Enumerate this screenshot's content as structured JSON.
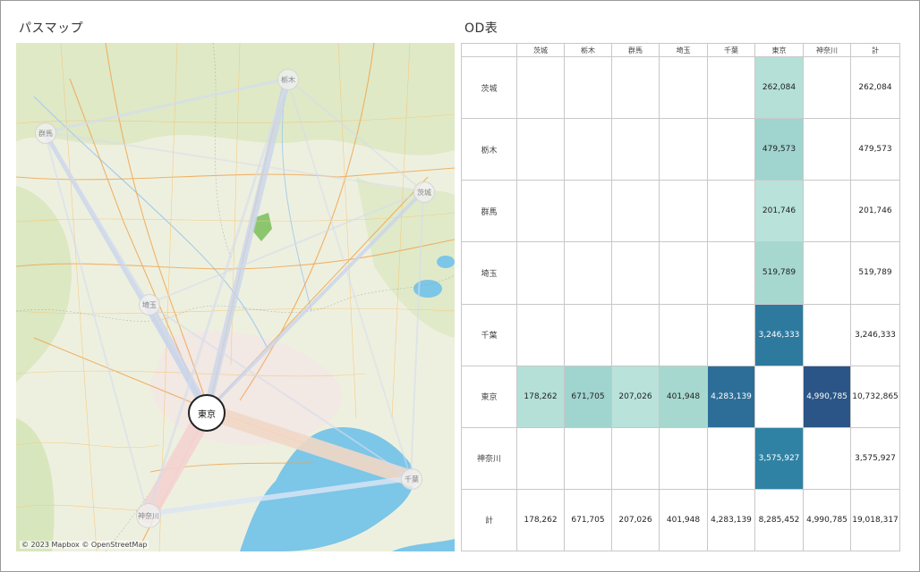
{
  "map": {
    "title": "パスマップ",
    "attribution": "© 2023 Mapbox © OpenStreetMap",
    "nodes": {
      "tochigi": "栃木",
      "gunma": "群馬",
      "ibaraki": "茨城",
      "saitama": "埼玉",
      "tokyo": "東京",
      "chiba": "千葉",
      "kanagawa": "神奈川"
    }
  },
  "od": {
    "title": "OD表",
    "columns": [
      "",
      "茨城",
      "栃木",
      "群馬",
      "埼玉",
      "千葉",
      "東京",
      "神奈川",
      "計"
    ],
    "rows": [
      {
        "label": "茨城",
        "cells": [
          "",
          "",
          "",
          "",
          "",
          "262,084",
          "",
          "262,084"
        ]
      },
      {
        "label": "栃木",
        "cells": [
          "",
          "",
          "",
          "",
          "",
          "479,573",
          "",
          "479,573"
        ]
      },
      {
        "label": "群馬",
        "cells": [
          "",
          "",
          "",
          "",
          "",
          "201,746",
          "",
          "201,746"
        ]
      },
      {
        "label": "埼玉",
        "cells": [
          "",
          "",
          "",
          "",
          "",
          "519,789",
          "",
          "519,789"
        ]
      },
      {
        "label": "千葉",
        "cells": [
          "",
          "",
          "",
          "",
          "",
          "3,246,333",
          "",
          "3,246,333"
        ]
      },
      {
        "label": "東京",
        "cells": [
          "178,262",
          "671,705",
          "207,026",
          "401,948",
          "4,283,139",
          "",
          "4,990,785",
          "10,732,865"
        ]
      },
      {
        "label": "神奈川",
        "cells": [
          "",
          "",
          "",
          "",
          "",
          "3,575,927",
          "",
          "3,575,927"
        ]
      },
      {
        "label": "計",
        "cells": [
          "178,262",
          "671,705",
          "207,026",
          "401,948",
          "4,283,139",
          "8,285,452",
          "4,990,785",
          "19,018,317"
        ]
      }
    ]
  },
  "colors": {
    "water": "#7cc6e8",
    "land": "#eef0df",
    "green": "#cfe3b2",
    "road_major": "#f0a24a",
    "road_minor": "#f5c77a",
    "flow": "#c9d4ea",
    "flow_tokyo_chiba": "#f1d7c6",
    "flow_tokyo_kanagawa": "#f3d3d0"
  }
}
